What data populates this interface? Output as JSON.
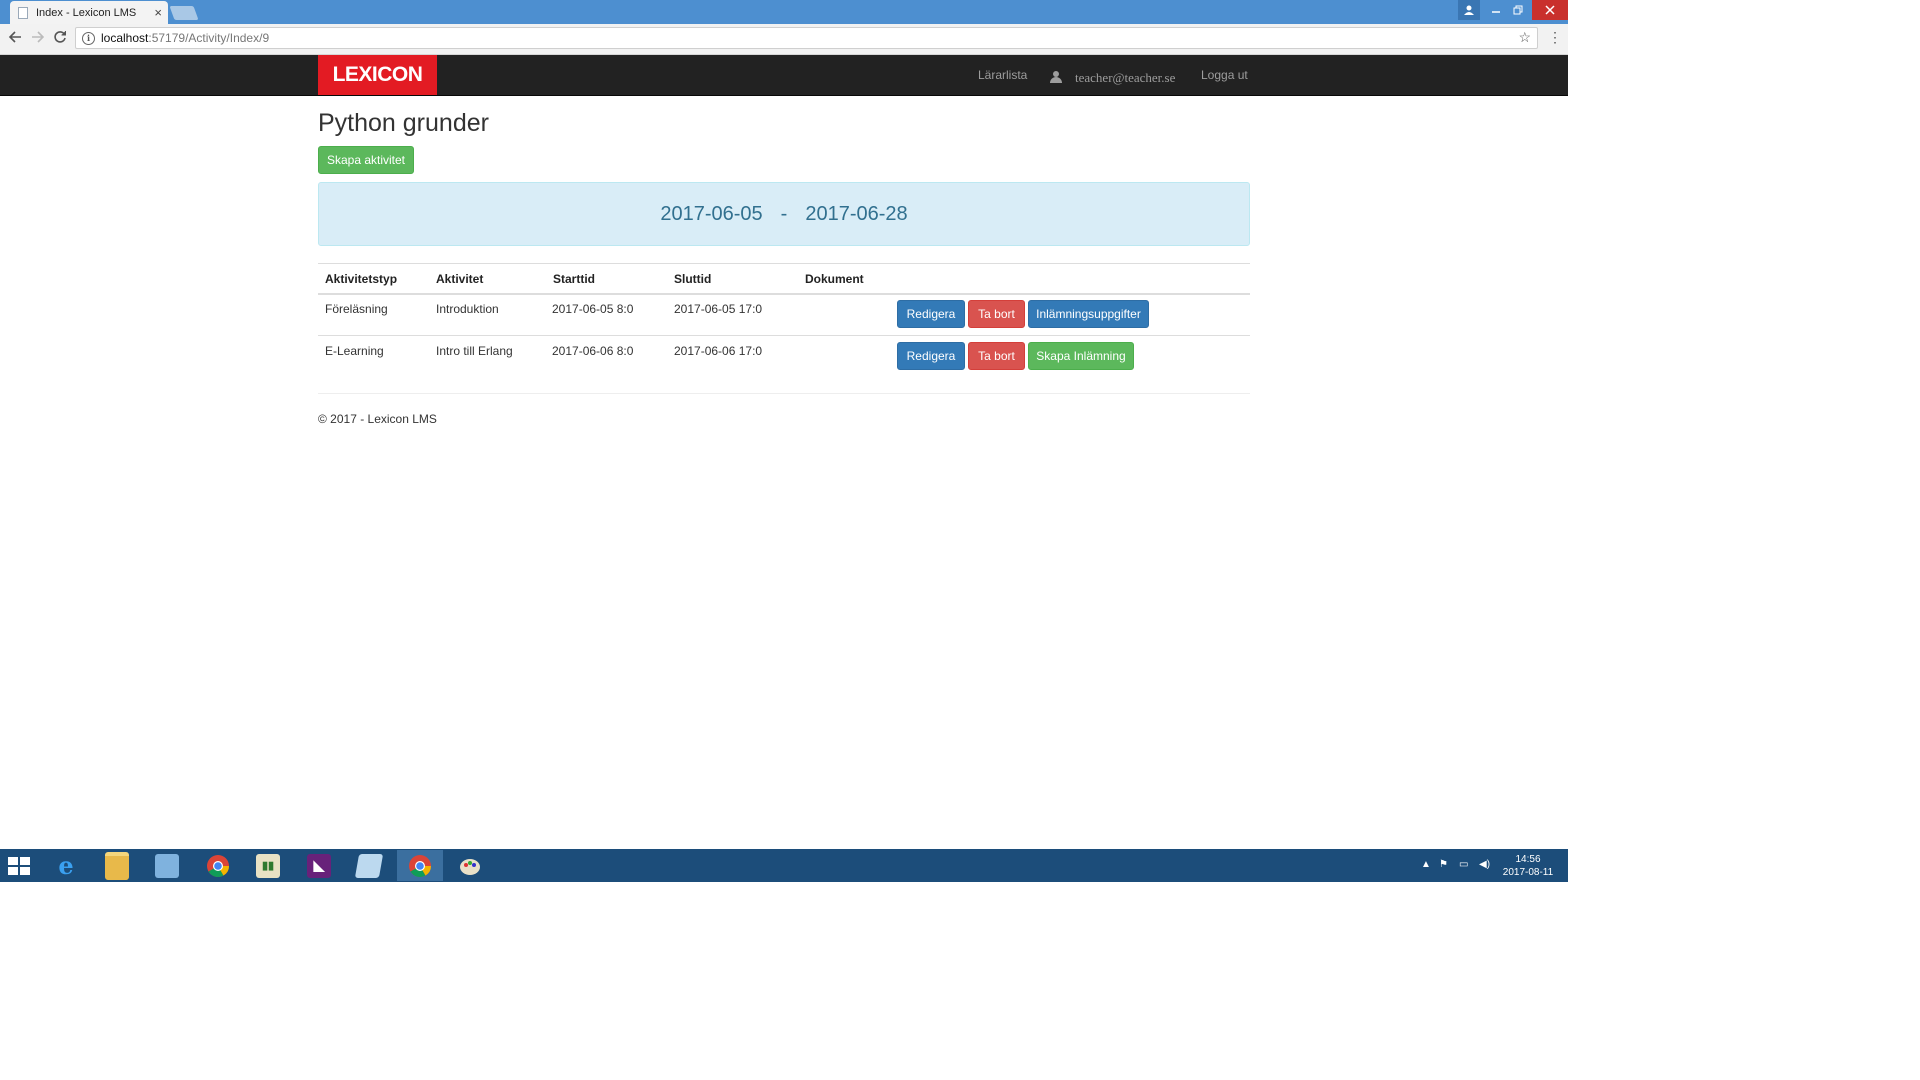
{
  "browser": {
    "tab_title": "Index - Lexicon LMS",
    "tab_close": "×",
    "url_host": "localhost",
    "url_path": ":57179/Activity/Index/9"
  },
  "navbar": {
    "brand": "LEXICON",
    "lararlista": "Lärarlista",
    "user_email": "teacher@teacher.se",
    "logout": "Logga ut"
  },
  "main": {
    "title": "Python grunder",
    "create_button": "Skapa aktivitet",
    "start_date": "2017-06-05",
    "separator": "-",
    "end_date": "2017-06-28"
  },
  "table": {
    "headers": [
      "Aktivitetstyp",
      "Aktivitet",
      "Starttid",
      "Sluttid",
      "Dokument"
    ],
    "rows": [
      {
        "type": "Föreläsning",
        "activity": "Introduktion",
        "start": "2017-06-05 8:0",
        "end": "2017-06-05 17:0",
        "edit": "Redigera",
        "delete": "Ta bort",
        "extra": "Inlämningsuppgifter"
      },
      {
        "type": "E-Learning",
        "activity": "Intro till Erlang",
        "start": "2017-06-06 8:0",
        "end": "2017-06-06 17:0",
        "edit": "Redigera",
        "delete": "Ta bort",
        "extra": "Skapa Inlämning"
      }
    ]
  },
  "footer": "© 2017 - Lexicon LMS",
  "taskbar": {
    "time": "14:56",
    "date": "2017-08-11"
  },
  "colors": {
    "brand_red": "#e31b23",
    "navbar_bg": "#222222",
    "primary": "#337ab7",
    "danger": "#d9534f",
    "success": "#5cb85c",
    "info_bg": "#d9edf7",
    "info_text": "#31708f"
  }
}
